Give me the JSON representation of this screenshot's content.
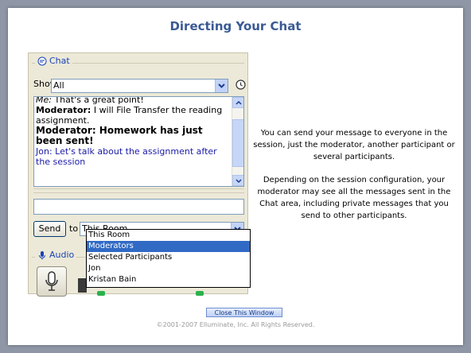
{
  "page_title": "Directing Your Chat",
  "chat": {
    "legend": "Chat",
    "show_label": "Show",
    "show_value": "All",
    "messages": [
      {
        "text": "Me: That's a great point!"
      },
      {
        "text": "Moderator: I will File Transfer the reading assignment."
      },
      {
        "text": "Moderator: Homework has just been sent!"
      },
      {
        "text": "Jon: Let's talk about the assignment after the session"
      }
    ],
    "input_value": "",
    "send_label": "Send",
    "to_label": "to",
    "to_value": "This Room",
    "dropdown_options": [
      "This Room",
      "Moderators",
      "Selected Participants",
      "Jon",
      "Kristan Bain"
    ],
    "dropdown_selected": "Moderators"
  },
  "audio": {
    "legend": "Audio"
  },
  "description": {
    "paragraph1": "You can send your message to everyone in the session, just the moderator, another participant or several participants.",
    "paragraph2": "Depending on the session configuration, your moderator may see all the messages sent in the Chat area, including private messages that you send to other participants."
  },
  "close_button": "Close This Window",
  "footer": "©2001-2007 Elluminate, Inc. All Rights Reserved.",
  "colors": {
    "title": "#3a5a94",
    "accent_selected": "#316ac5",
    "panel_bg": "#ece9d8",
    "message_blue": "#1a1aa8"
  },
  "icons": {
    "chat_legend": "chat-bubble-icon",
    "audio_legend": "audio-icon",
    "history": "clock-icon",
    "dropdown": "chevron-down-icon",
    "microphone": "microphone-icon"
  }
}
